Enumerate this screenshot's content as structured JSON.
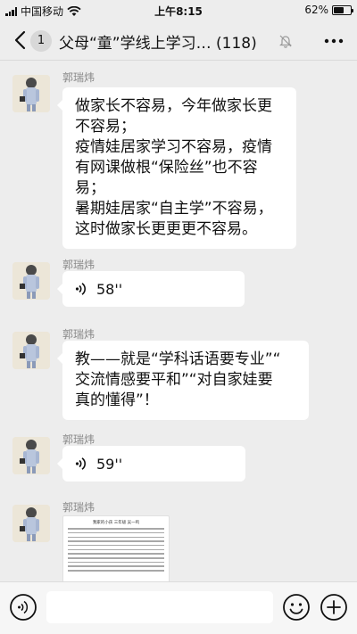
{
  "status_bar": {
    "carrier": "中国移动",
    "time": "上午8:15",
    "battery": "62%",
    "battery_level": 0.62
  },
  "nav": {
    "back_count": "1",
    "title": "父母“童”学线上学习… (118)"
  },
  "messages": [
    {
      "sender": "郭瑞炜",
      "type": "text",
      "text": "做家长不容易，今年做家长更\n不容易；\n疫情娃居家学习不容易，疫情\n有网课做根“保险丝”也不容\n易；\n暑期娃居家“自主学”不容易，\n这时做家长更更更不容易。"
    },
    {
      "sender": "郭瑞炜",
      "type": "voice",
      "duration": "58''"
    },
    {
      "sender": "郭瑞炜",
      "type": "text",
      "text": "教——就是“学科话语要专业”“\n交流情感要平和”“对自家娃要\n真的懂得”！"
    },
    {
      "sender": "郭瑞炜",
      "type": "voice",
      "duration": "59''"
    },
    {
      "sender": "郭瑞炜",
      "type": "image",
      "image_title": "我家的小孩 三年级 吴一鸣"
    }
  ],
  "input_bar": {
    "placeholder": ""
  },
  "colors": {
    "background": "#ededed",
    "bubble": "#ffffff",
    "sender_name": "#888888"
  }
}
